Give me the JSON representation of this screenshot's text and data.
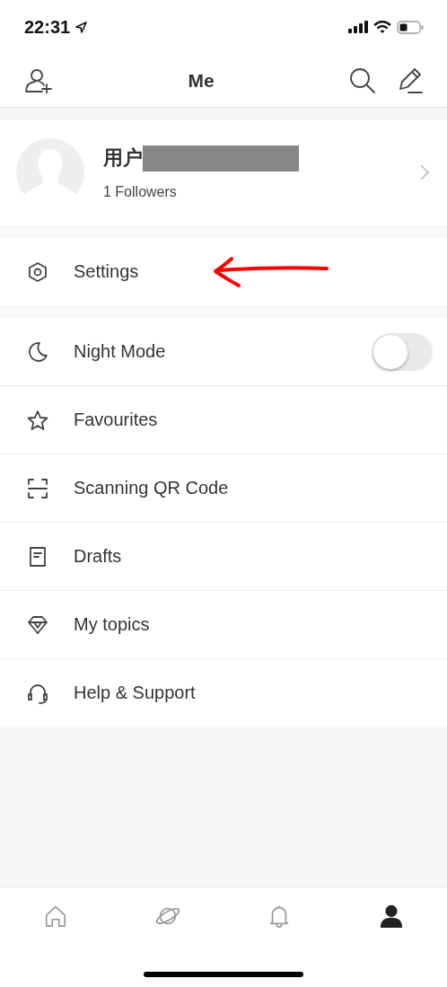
{
  "status_bar": {
    "time": "22:31"
  },
  "header": {
    "title": "Me"
  },
  "profile": {
    "name": "用户",
    "followers": "1 Followers"
  },
  "menu_groups": [
    [
      {
        "kind": "plain",
        "label": "Settings",
        "annotated": true
      }
    ],
    [
      {
        "kind": "toggle",
        "label": "Night Mode",
        "on": false
      },
      {
        "kind": "plain",
        "label": "Favourites"
      },
      {
        "kind": "plain",
        "label": "Scanning QR Code"
      },
      {
        "kind": "plain",
        "label": "Drafts"
      },
      {
        "kind": "plain",
        "label": "My topics"
      },
      {
        "kind": "plain",
        "label": "Help & Support"
      }
    ]
  ],
  "tabs": [
    {
      "selected": false
    },
    {
      "selected": false
    },
    {
      "selected": false
    },
    {
      "selected": true
    }
  ]
}
